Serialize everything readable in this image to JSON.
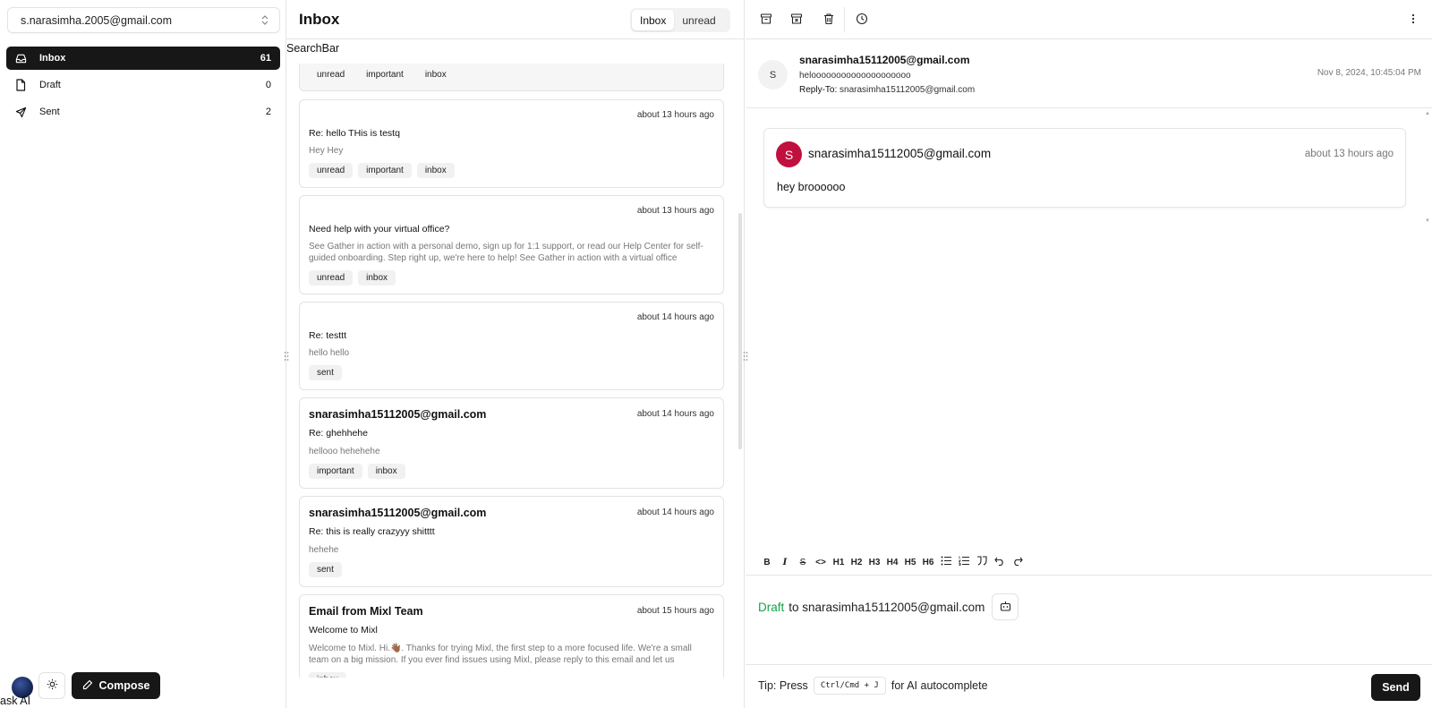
{
  "account": {
    "email": "s.narasimha.2005@gmail.com"
  },
  "nav": {
    "items": [
      {
        "label": "Inbox",
        "count": "61",
        "icon": "inbox-icon",
        "active": true
      },
      {
        "label": "Draft",
        "count": "0",
        "icon": "file-icon",
        "active": false
      },
      {
        "label": "Sent",
        "count": "2",
        "icon": "send-icon",
        "active": false
      }
    ]
  },
  "footer": {
    "compose_label": "Compose",
    "ask_ai_label": "ask AI"
  },
  "mail_list": {
    "title": "Inbox",
    "tabs": [
      "Inbox",
      "unread"
    ],
    "search_label": "SearchBar",
    "items": [
      {
        "from": "",
        "time": "",
        "subject": "",
        "preview": "",
        "tags": [
          "unread",
          "important",
          "inbox"
        ]
      },
      {
        "from": "",
        "time": "about 13 hours ago",
        "subject": "Re: hello THis is testq",
        "preview": "Hey Hey",
        "tags": [
          "unread",
          "important",
          "inbox"
        ]
      },
      {
        "from": "",
        "time": "about 13 hours ago",
        "subject": "Need help with your virtual office?",
        "preview": "See Gather in action with a personal demo, sign up for 1:1 support, or read our Help Center for self-guided onboarding. Step right up, we're here to help! See Gather in action with a virtual office",
        "tags": [
          "unread",
          "inbox"
        ]
      },
      {
        "from": "",
        "time": "about 14 hours ago",
        "subject": "Re: testtt",
        "preview": "hello hello",
        "tags": [
          "sent"
        ]
      },
      {
        "from": "snarasimha15112005@gmail.com",
        "time": "about 14 hours ago",
        "subject": "Re: ghehhehe",
        "preview": "hellooo hehehehe",
        "tags": [
          "important",
          "inbox"
        ]
      },
      {
        "from": "snarasimha15112005@gmail.com",
        "time": "about 14 hours ago",
        "subject": "Re: this is really crazyyy shitttt",
        "preview": "hehehe",
        "tags": [
          "sent"
        ]
      },
      {
        "from": "Email from Mixl Team",
        "time": "about 15 hours ago",
        "subject": "Welcome to Mixl",
        "preview": "Welcome to Mixl. Hi.👋🏾. Thanks for trying Mixl, the first step to a more focused life. We're a small team on a big mission. If you ever find issues using Mixl, please reply to this email and let us",
        "tags": [
          "inbox"
        ]
      }
    ]
  },
  "thread": {
    "header": {
      "avatar_letter": "S",
      "from": "snarasimha15112005@gmail.com",
      "subject": "heloooooooooooooooooooo",
      "reply_to_label": "Reply-To:",
      "reply_to": "snarasimha15112005@gmail.com",
      "date": "Nov 8, 2024, 10:45:04 PM"
    },
    "messages": [
      {
        "avatar_letter": "S",
        "from": "snarasimha15112005@gmail.com",
        "time": "about 13 hours ago",
        "body": "hey broooooo"
      }
    ],
    "toolbar_icons": [
      "archive-icon",
      "archive-x-icon",
      "trash-icon",
      "clock-icon",
      "more-vertical-icon"
    ]
  },
  "editor": {
    "format_buttons": [
      "B",
      "I",
      "S",
      "<>",
      "H1",
      "H2",
      "H3",
      "H4",
      "H5",
      "H6"
    ],
    "draft_label": "Draft",
    "draft_to": "to snarasimha15112005@gmail.com",
    "tip_prefix": "Tip: Press",
    "tip_shortcut": "Ctrl/Cmd + J",
    "tip_suffix": "for AI autocomplete",
    "send_label": "Send"
  },
  "colors": {
    "primary": "#171717",
    "avatar_red": "#c0103d",
    "draft_green": "#16a34a",
    "tag_bg": "#f1f1f1"
  }
}
